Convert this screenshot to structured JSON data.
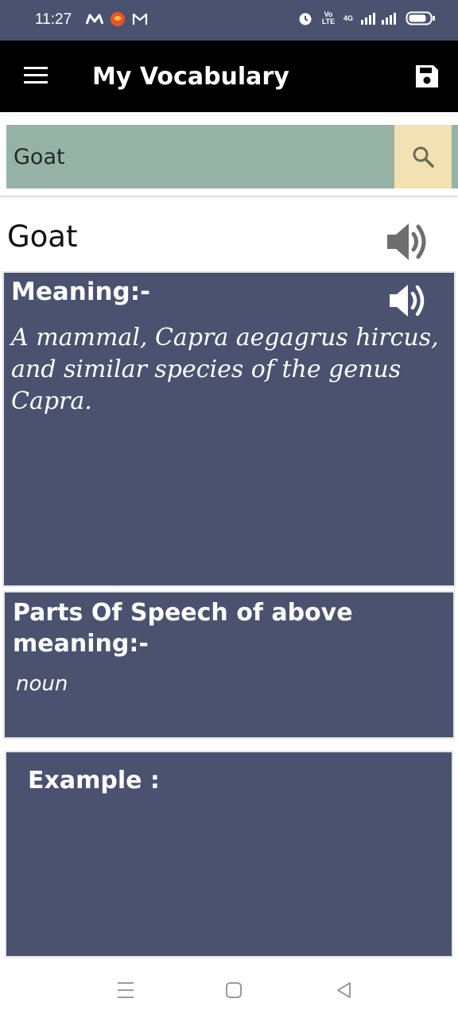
{
  "status_bar": {
    "time": "11:27",
    "left_icons": [
      "m-app-icon",
      "swiggy-icon",
      "gmail-icon"
    ],
    "volte_label": "Vo LTE",
    "network_label": "4G",
    "right_icons": [
      "alarm-icon",
      "signal-icon",
      "battery-icon"
    ]
  },
  "app_bar": {
    "title": "My Vocabulary",
    "icons": [
      "menu-icon",
      "save-icon"
    ]
  },
  "search": {
    "value": "Goat",
    "icon": "search-icon"
  },
  "word": {
    "text": "Goat",
    "icon": "speaker-icon"
  },
  "meaning": {
    "title": "Meaning:-",
    "text": "A mammal, Capra aegagrus hircus, and similar species of the genus Capra.",
    "icon": "speaker-icon"
  },
  "part_of_speech": {
    "title": "Parts Of Speech of above meaning:-",
    "value": "noun"
  },
  "example": {
    "title": "Example :"
  },
  "nav_bar": {
    "icons": [
      "recent-apps-icon",
      "home-icon",
      "back-icon"
    ]
  },
  "colors": {
    "card_bg": "#4a5270",
    "search_bg": "#97b3a8",
    "search_button_bg": "#f2e1b2",
    "app_bar_bg": "#000000"
  }
}
